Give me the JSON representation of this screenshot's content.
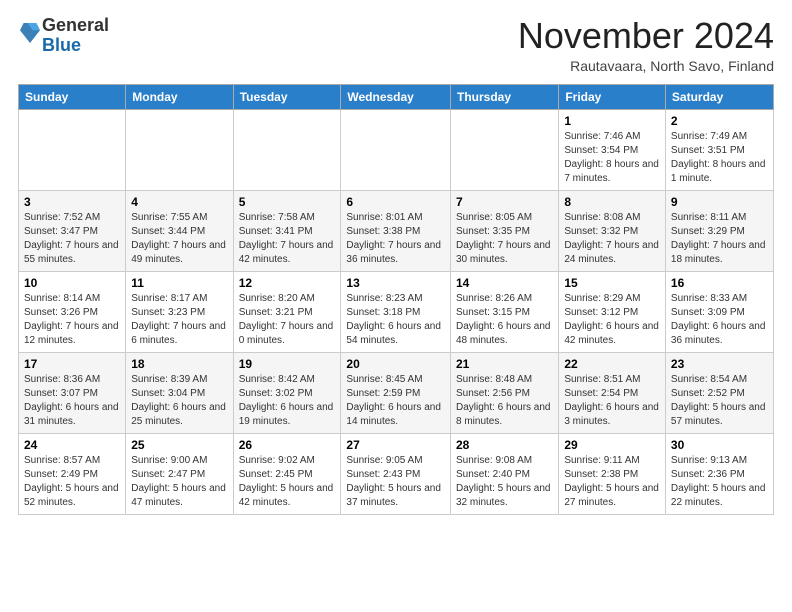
{
  "logo": {
    "general": "General",
    "blue": "Blue"
  },
  "header": {
    "month": "November 2024",
    "location": "Rautavaara, North Savo, Finland"
  },
  "days_of_week": [
    "Sunday",
    "Monday",
    "Tuesday",
    "Wednesday",
    "Thursday",
    "Friday",
    "Saturday"
  ],
  "weeks": [
    [
      {
        "day": "",
        "info": ""
      },
      {
        "day": "",
        "info": ""
      },
      {
        "day": "",
        "info": ""
      },
      {
        "day": "",
        "info": ""
      },
      {
        "day": "",
        "info": ""
      },
      {
        "day": "1",
        "info": "Sunrise: 7:46 AM\nSunset: 3:54 PM\nDaylight: 8 hours and 7 minutes."
      },
      {
        "day": "2",
        "info": "Sunrise: 7:49 AM\nSunset: 3:51 PM\nDaylight: 8 hours and 1 minute."
      }
    ],
    [
      {
        "day": "3",
        "info": "Sunrise: 7:52 AM\nSunset: 3:47 PM\nDaylight: 7 hours and 55 minutes."
      },
      {
        "day": "4",
        "info": "Sunrise: 7:55 AM\nSunset: 3:44 PM\nDaylight: 7 hours and 49 minutes."
      },
      {
        "day": "5",
        "info": "Sunrise: 7:58 AM\nSunset: 3:41 PM\nDaylight: 7 hours and 42 minutes."
      },
      {
        "day": "6",
        "info": "Sunrise: 8:01 AM\nSunset: 3:38 PM\nDaylight: 7 hours and 36 minutes."
      },
      {
        "day": "7",
        "info": "Sunrise: 8:05 AM\nSunset: 3:35 PM\nDaylight: 7 hours and 30 minutes."
      },
      {
        "day": "8",
        "info": "Sunrise: 8:08 AM\nSunset: 3:32 PM\nDaylight: 7 hours and 24 minutes."
      },
      {
        "day": "9",
        "info": "Sunrise: 8:11 AM\nSunset: 3:29 PM\nDaylight: 7 hours and 18 minutes."
      }
    ],
    [
      {
        "day": "10",
        "info": "Sunrise: 8:14 AM\nSunset: 3:26 PM\nDaylight: 7 hours and 12 minutes."
      },
      {
        "day": "11",
        "info": "Sunrise: 8:17 AM\nSunset: 3:23 PM\nDaylight: 7 hours and 6 minutes."
      },
      {
        "day": "12",
        "info": "Sunrise: 8:20 AM\nSunset: 3:21 PM\nDaylight: 7 hours and 0 minutes."
      },
      {
        "day": "13",
        "info": "Sunrise: 8:23 AM\nSunset: 3:18 PM\nDaylight: 6 hours and 54 minutes."
      },
      {
        "day": "14",
        "info": "Sunrise: 8:26 AM\nSunset: 3:15 PM\nDaylight: 6 hours and 48 minutes."
      },
      {
        "day": "15",
        "info": "Sunrise: 8:29 AM\nSunset: 3:12 PM\nDaylight: 6 hours and 42 minutes."
      },
      {
        "day": "16",
        "info": "Sunrise: 8:33 AM\nSunset: 3:09 PM\nDaylight: 6 hours and 36 minutes."
      }
    ],
    [
      {
        "day": "17",
        "info": "Sunrise: 8:36 AM\nSunset: 3:07 PM\nDaylight: 6 hours and 31 minutes."
      },
      {
        "day": "18",
        "info": "Sunrise: 8:39 AM\nSunset: 3:04 PM\nDaylight: 6 hours and 25 minutes."
      },
      {
        "day": "19",
        "info": "Sunrise: 8:42 AM\nSunset: 3:02 PM\nDaylight: 6 hours and 19 minutes."
      },
      {
        "day": "20",
        "info": "Sunrise: 8:45 AM\nSunset: 2:59 PM\nDaylight: 6 hours and 14 minutes."
      },
      {
        "day": "21",
        "info": "Sunrise: 8:48 AM\nSunset: 2:56 PM\nDaylight: 6 hours and 8 minutes."
      },
      {
        "day": "22",
        "info": "Sunrise: 8:51 AM\nSunset: 2:54 PM\nDaylight: 6 hours and 3 minutes."
      },
      {
        "day": "23",
        "info": "Sunrise: 8:54 AM\nSunset: 2:52 PM\nDaylight: 5 hours and 57 minutes."
      }
    ],
    [
      {
        "day": "24",
        "info": "Sunrise: 8:57 AM\nSunset: 2:49 PM\nDaylight: 5 hours and 52 minutes."
      },
      {
        "day": "25",
        "info": "Sunrise: 9:00 AM\nSunset: 2:47 PM\nDaylight: 5 hours and 47 minutes."
      },
      {
        "day": "26",
        "info": "Sunrise: 9:02 AM\nSunset: 2:45 PM\nDaylight: 5 hours and 42 minutes."
      },
      {
        "day": "27",
        "info": "Sunrise: 9:05 AM\nSunset: 2:43 PM\nDaylight: 5 hours and 37 minutes."
      },
      {
        "day": "28",
        "info": "Sunrise: 9:08 AM\nSunset: 2:40 PM\nDaylight: 5 hours and 32 minutes."
      },
      {
        "day": "29",
        "info": "Sunrise: 9:11 AM\nSunset: 2:38 PM\nDaylight: 5 hours and 27 minutes."
      },
      {
        "day": "30",
        "info": "Sunrise: 9:13 AM\nSunset: 2:36 PM\nDaylight: 5 hours and 22 minutes."
      }
    ]
  ]
}
